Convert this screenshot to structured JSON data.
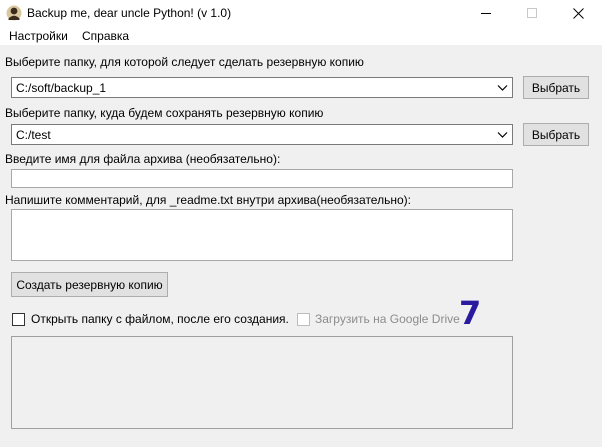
{
  "window": {
    "title": "Backup me, dear uncle Python! (v 1.0)"
  },
  "menu": {
    "items": [
      {
        "label": "Настройки"
      },
      {
        "label": "Справка"
      }
    ]
  },
  "source": {
    "label": "Выберите папку, для которой следует сделать резервную копию",
    "value": "C:/soft/backup_1",
    "button": "Выбрать"
  },
  "destination": {
    "label": "Выберите папку, куда будем сохранять резервную копию",
    "value": "C:/test",
    "button": "Выбрать"
  },
  "archive_name": {
    "label": "Введите имя для файла архива (необязательно):",
    "value": ""
  },
  "comment": {
    "label": "Напишите комментарий, для _readme.txt внутри архива(необязательно):",
    "value": ""
  },
  "create_button": {
    "label": "Создать резервную копию"
  },
  "options": {
    "open_folder": {
      "label": "Открыть папку с файлом, после его создания.",
      "checked": false
    },
    "google_drive": {
      "label": "Загрузить на Google Drive",
      "checked": false,
      "enabled": false
    }
  },
  "step_number": "7",
  "colors": {
    "step_number": "#2a1aa0",
    "window_bg": "#f0f0f0"
  }
}
